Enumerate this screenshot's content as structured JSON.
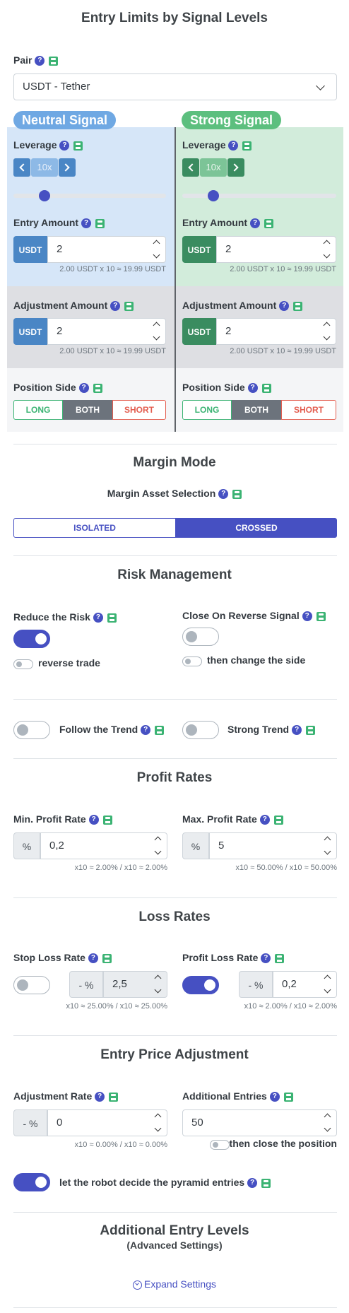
{
  "page_title": "Entry Limits by Signal Levels",
  "pair": {
    "label": "Pair",
    "value": "USDT - Tether"
  },
  "neutral": {
    "badge": "Neutral Signal",
    "leverage_label": "Leverage",
    "leverage_value": "10x",
    "entry_label": "Entry Amount",
    "entry_unit": "USDT",
    "entry_value": "2",
    "entry_hint": "2.00 USDT x 10 ≈ 19.99 USDT",
    "adj_label": "Adjustment Amount",
    "adj_unit": "USDT",
    "adj_value": "2",
    "adj_hint": "2.00 USDT x 10 ≈ 19.99 USDT",
    "side_label": "Position Side",
    "side_long": "LONG",
    "side_both": "BOTH",
    "side_short": "SHORT"
  },
  "strong": {
    "badge": "Strong Signal",
    "leverage_label": "Leverage",
    "leverage_value": "10x",
    "entry_label": "Entry Amount",
    "entry_unit": "USDT",
    "entry_value": "2",
    "entry_hint": "2.00 USDT x 10 ≈ 19.99 USDT",
    "adj_label": "Adjustment Amount",
    "adj_unit": "USDT",
    "adj_value": "2",
    "adj_hint": "2.00 USDT x 10 ≈ 19.99 USDT",
    "side_label": "Position Side",
    "side_long": "LONG",
    "side_both": "BOTH",
    "side_short": "SHORT"
  },
  "margin": {
    "title": "Margin Mode",
    "asset_label": "Margin Asset Selection",
    "isolated": "ISOLATED",
    "crossed": "CROSSED"
  },
  "risk": {
    "title": "Risk Management",
    "reduce_label": "Reduce the Risk",
    "reverse_trade": "reverse trade",
    "close_reverse_label": "Close On Reverse Signal",
    "change_side": "then change the side",
    "follow_trend": "Follow the Trend",
    "strong_trend": "Strong Trend"
  },
  "profit": {
    "title": "Profit Rates",
    "min_label": "Min. Profit Rate",
    "min_unit": "%",
    "min_value": "0,2",
    "min_hint": "x10 ≈ 2.00% / x10 ≈ 2.00%",
    "max_label": "Max. Profit Rate",
    "max_unit": "%",
    "max_value": "5",
    "max_hint": "x10 ≈ 50.00% / x10 ≈ 50.00%"
  },
  "loss": {
    "title": "Loss Rates",
    "stop_label": "Stop Loss Rate",
    "stop_unit": "- %",
    "stop_value": "2,5",
    "stop_hint": "x10 ≈ 25.00% / x10 ≈ 25.00%",
    "profit_loss_label": "Profit Loss Rate",
    "profit_loss_unit": "- %",
    "profit_loss_value": "0,2",
    "profit_loss_hint": "x10 ≈ 2.00% / x10 ≈ 2.00%"
  },
  "entry_adj": {
    "title": "Entry Price Adjustment",
    "rate_label": "Adjustment Rate",
    "rate_unit": "- %",
    "rate_value": "0",
    "rate_hint": "x10 ≈ 0.00% / x10 ≈ 0.00%",
    "add_label": "Additional Entries",
    "add_value": "50",
    "close_position": "then close the position",
    "pyramid": "let the robot decide the pyramid entries"
  },
  "additional": {
    "title": "Additional Entry Levels",
    "subtitle": "(Advanced Settings)",
    "expand": "Expand Settings"
  },
  "colors": {
    "accent": "#4650c2",
    "neutral_bg": "#d6e6f8",
    "strong_bg": "#d2ecdb",
    "neutral_badge": "#6fa8e3",
    "strong_badge": "#5cbf7e"
  }
}
